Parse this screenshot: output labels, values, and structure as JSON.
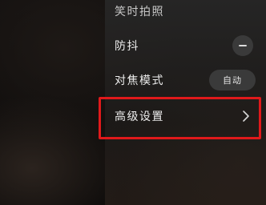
{
  "menu": {
    "items": [
      {
        "label": "笑时拍照",
        "control": "none"
      },
      {
        "label": "防抖",
        "control": "minus"
      },
      {
        "label": "对焦模式",
        "control": "pill",
        "value": "自动"
      },
      {
        "label": "高级设置",
        "control": "chevron",
        "highlighted": true
      }
    ]
  },
  "colors": {
    "highlight_border": "#e0191b",
    "panel": "#2a2725",
    "text": "#ededed"
  },
  "icons": {
    "minus": "minus-icon",
    "chevron": "chevron-right-icon"
  }
}
